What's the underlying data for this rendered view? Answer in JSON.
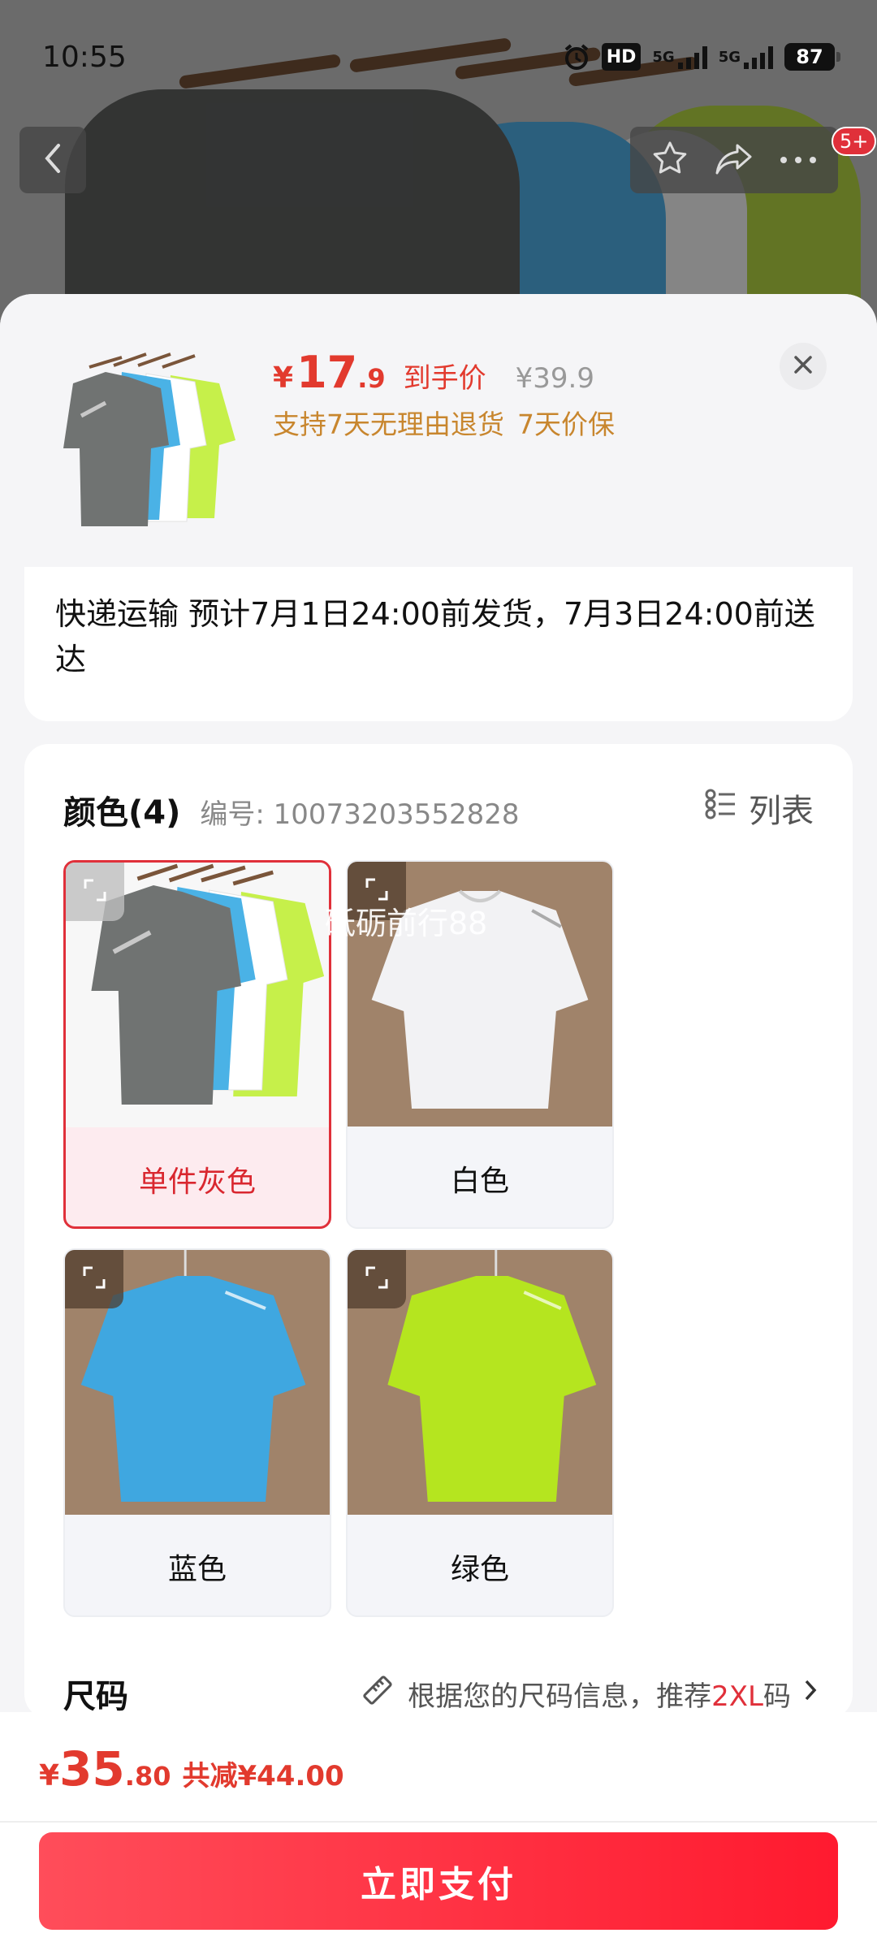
{
  "status_bar": {
    "time": "10:55",
    "hd_label": "HD",
    "net1": "5G",
    "net2": "5G",
    "battery": "87"
  },
  "top_nav": {
    "back_icon": "chevron-left-icon",
    "favorite_icon": "star-icon",
    "share_icon": "share-icon",
    "more_icon": "more-icon",
    "message_badge": "5+"
  },
  "product": {
    "price_symbol": "¥",
    "price_integer": "17",
    "price_decimal": ".9",
    "price_label": "到手价",
    "original_price": "¥39.9",
    "perk_return": "支持7天无理由退货",
    "perk_price_protect": "7天价保"
  },
  "shipping": {
    "text": "快递运输 预计7月1日24:00前发货，7月3日24:00前送达"
  },
  "spec": {
    "title": "颜色(4)",
    "code": "编号: 10073203552828",
    "list_toggle": "列表",
    "options": [
      {
        "name": "单件灰色",
        "selected": true
      },
      {
        "name": "白色",
        "selected": false
      },
      {
        "name": "蓝色",
        "selected": false
      },
      {
        "name": "绿色",
        "selected": false
      }
    ],
    "watermark": "砥砺前行88"
  },
  "size": {
    "title": "尺码",
    "rec_prefix": "根据您的尺码信息，推荐",
    "rec_size": "2XL",
    "rec_suffix": "码"
  },
  "footer": {
    "price_symbol": "¥",
    "price_integer": "35",
    "price_decimal": ".80",
    "savings": "共减¥44.00",
    "pay_button": "立即支付"
  },
  "colors": {
    "accent": "#e0303a",
    "price": "#e23a2e",
    "perk": "#c8862e"
  }
}
